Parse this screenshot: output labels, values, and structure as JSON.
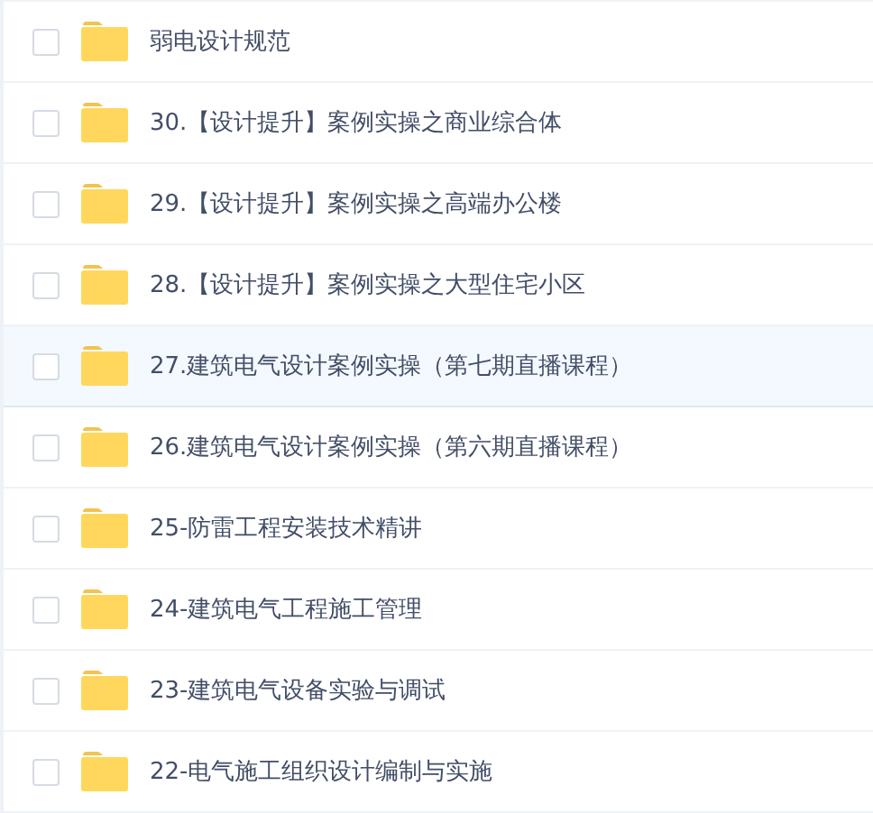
{
  "files": [
    {
      "name": "弱电设计规范",
      "checked": false,
      "selected": false
    },
    {
      "name": "30.【设计提升】案例实操之商业综合体",
      "checked": false,
      "selected": false
    },
    {
      "name": "29.【设计提升】案例实操之高端办公楼",
      "checked": false,
      "selected": false
    },
    {
      "name": "28.【设计提升】案例实操之大型住宅小区",
      "checked": false,
      "selected": false
    },
    {
      "name": "27.建筑电气设计案例实操（第七期直播课程）",
      "checked": false,
      "selected": true
    },
    {
      "name": "26.建筑电气设计案例实操（第六期直播课程）",
      "checked": false,
      "selected": false
    },
    {
      "name": "25-防雷工程安装技术精讲",
      "checked": false,
      "selected": false
    },
    {
      "name": "24-建筑电气工程施工管理",
      "checked": false,
      "selected": false
    },
    {
      "name": "23-建筑电气设备实验与调试",
      "checked": false,
      "selected": false
    },
    {
      "name": "22-电气施工组织设计编制与实施",
      "checked": false,
      "selected": false
    }
  ]
}
